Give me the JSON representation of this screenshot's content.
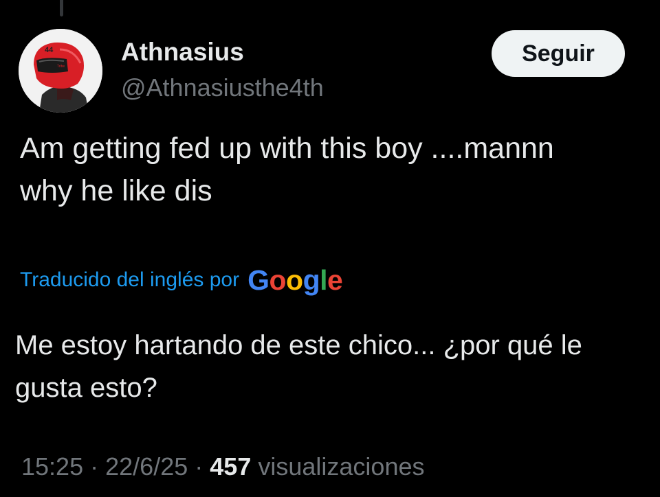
{
  "tweet": {
    "author": {
      "display_name": "Athnasius",
      "handle": "@Athnasiusthe4th",
      "avatar_badge": "44"
    },
    "follow_label": "Seguir",
    "text_line1": "Am getting fed up with this boy ....mannn",
    "text_line2": "why he like dis",
    "translation": {
      "label": "Traducido del inglés por",
      "provider": "Google",
      "text_line1": "Me estoy hartando de este chico... ¿por qué le",
      "text_line2": "gusta esto?"
    },
    "time": "15:25",
    "separator": "·",
    "date": "22/6/25",
    "views_count": "457",
    "views_label": "visualizaciones"
  },
  "colors": {
    "background": "#000000",
    "text_primary": "#e7e9ea",
    "text_secondary": "#71767b",
    "link_blue": "#1d9bf0",
    "button_bg": "#eff3f4",
    "google_blue": "#4285f4",
    "google_red": "#ea4335",
    "google_yellow": "#fbbc05",
    "google_green": "#34a853",
    "helmet_red": "#d81f26"
  },
  "icons": {
    "avatar": "red-helmet-rider-avatar"
  }
}
